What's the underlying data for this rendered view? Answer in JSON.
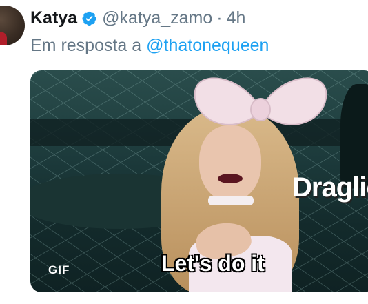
{
  "tweet": {
    "author_name": "Katya",
    "handle": "@katya_zamo",
    "separator": "·",
    "time": "4h",
    "reply_prefix": "Em resposta a",
    "reply_mention": "@thatonequeen"
  },
  "media": {
    "type_badge": "GIF",
    "caption": "Let's do it",
    "watermark": "Draglic"
  },
  "colors": {
    "name": "#14171a",
    "secondary_text": "#657786",
    "link": "#1da1f2",
    "verified_badge": "#1da1f2"
  },
  "icons": {
    "verified": "verified-badge-icon"
  }
}
